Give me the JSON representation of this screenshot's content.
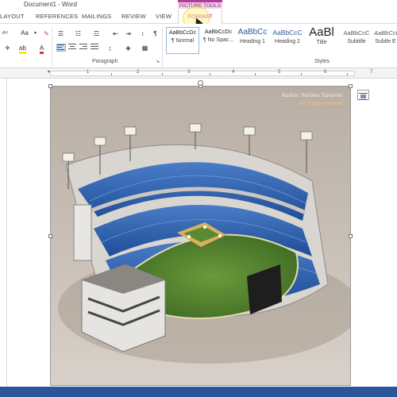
{
  "window": {
    "title": "Document1 - Word"
  },
  "context_tab": {
    "title": "PICTURE TOOLS"
  },
  "tabs": [
    {
      "label": "LAYOUT"
    },
    {
      "label": "REFERENCES"
    },
    {
      "label": "MAILINGS"
    },
    {
      "label": "REVIEW"
    },
    {
      "label": "VIEW"
    },
    {
      "label": "FORMAT"
    }
  ],
  "ribbon": {
    "font_size_label": "Aa",
    "groups": {
      "paragraph": "Paragraph",
      "styles": "Styles"
    },
    "styles": [
      {
        "sample": "AaBbCcDc",
        "name": "¶ Normal"
      },
      {
        "sample": "AaBbCcDc",
        "name": "¶ No Spac..."
      },
      {
        "sample": "AaBbCc",
        "name": "Heading 1"
      },
      {
        "sample": "AaBbCcC",
        "name": "Heading 2"
      },
      {
        "sample": "AaBl",
        "name": "Title"
      },
      {
        "sample": "AaBbCcC",
        "name": "Subtitle"
      },
      {
        "sample": "AaBbCcD",
        "name": "Subtle E"
      }
    ]
  },
  "ruler": {
    "numbers": [
      "1",
      "2",
      "3",
      "4",
      "5",
      "6",
      "7"
    ]
  },
  "picture": {
    "author_line": "Author: Stefano Tartarotti",
    "rights_line": "All rights reserved"
  },
  "colors": {
    "word_blue": "#2b579a",
    "picture_tools_accent": "#b23c9a",
    "field_green": "#4e7a2c",
    "seat_blue": "#2f5fa8"
  }
}
